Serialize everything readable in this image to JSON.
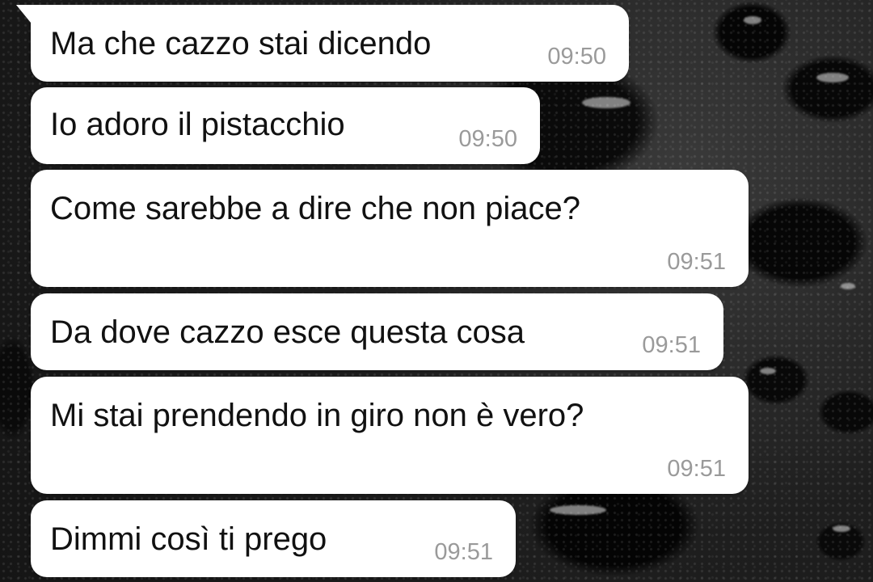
{
  "messages": [
    {
      "text": "Ma che cazzo stai dicendo",
      "time": "09:50"
    },
    {
      "text": "Io adoro il pistacchio",
      "time": "09:50"
    },
    {
      "text": "Come sarebbe a dire che non piace?",
      "time": "09:51"
    },
    {
      "text": "Da dove cazzo esce questa cosa",
      "time": "09:51"
    },
    {
      "text": "Mi stai prendendo in giro non è vero?",
      "time": "09:51"
    },
    {
      "text": "Dimmi così ti prego",
      "time": "09:51"
    }
  ],
  "colors": {
    "bubble": "#ffffff",
    "text": "#111111",
    "timestamp": "#9a9a9a",
    "wallpaper": "#1b1b1b"
  }
}
